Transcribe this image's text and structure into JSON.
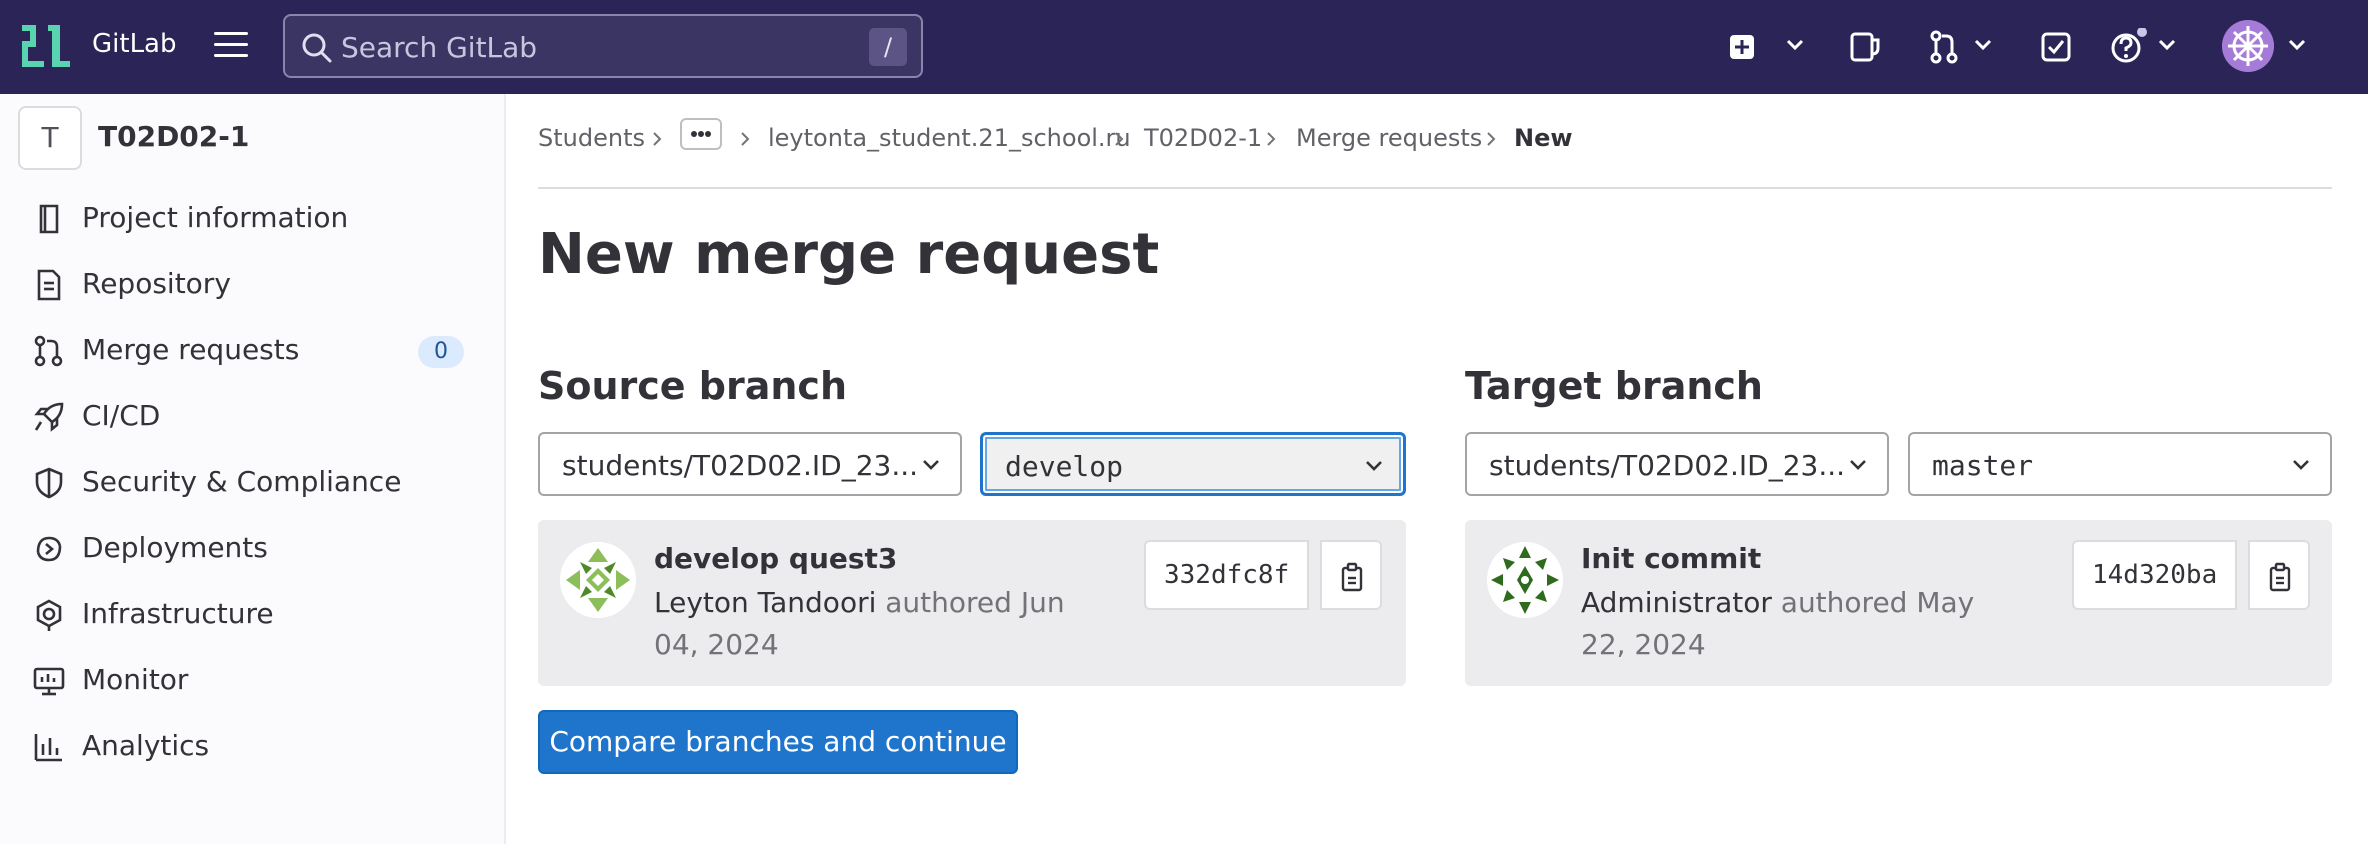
{
  "app": {
    "brand": "GitLab"
  },
  "search": {
    "placeholder": "Search GitLab",
    "shortcut": "/"
  },
  "top_nav": {
    "icons": [
      "new-item-icon",
      "issues-icon",
      "merge-requests-icon",
      "todos-icon",
      "help-icon",
      "user-avatar"
    ]
  },
  "sidebar": {
    "project_initial": "T",
    "project_name": "T02D02-1",
    "items": [
      {
        "label": "Project information",
        "icon": "project-information-icon"
      },
      {
        "label": "Repository",
        "icon": "repository-icon"
      },
      {
        "label": "Merge requests",
        "icon": "merge-requests-icon",
        "badge": "0"
      },
      {
        "label": "CI/CD",
        "icon": "rocket-icon"
      },
      {
        "label": "Security & Compliance",
        "icon": "shield-icon"
      },
      {
        "label": "Deployments",
        "icon": "deployments-icon"
      },
      {
        "label": "Infrastructure",
        "icon": "infrastructure-icon"
      },
      {
        "label": "Monitor",
        "icon": "monitor-icon"
      },
      {
        "label": "Analytics",
        "icon": "analytics-icon"
      }
    ]
  },
  "breadcrumb": {
    "items": [
      "Students",
      "leytonta_student.21_school.ru",
      "T02D02-1",
      "Merge requests"
    ],
    "current": "New"
  },
  "page": {
    "title": "New merge request"
  },
  "source": {
    "heading": "Source branch",
    "project": "students/T02D02.ID_23...",
    "branch": "develop",
    "commit": {
      "title": "develop quest3",
      "author": "Leyton Tandoori",
      "meta": "authored Jun 04, 2024",
      "sha": "332dfc8f"
    }
  },
  "target": {
    "heading": "Target branch",
    "project": "students/T02D02.ID_23...",
    "branch": "master",
    "commit": {
      "title": "Init commit",
      "author": "Administrator",
      "meta": "authored May 22, 2024",
      "sha": "14d320ba"
    }
  },
  "actions": {
    "compare_label": "Compare branches and continue"
  },
  "colors": {
    "navbar": "#2b2457",
    "primary": "#1f75cb",
    "logo": "#59d3b0"
  }
}
